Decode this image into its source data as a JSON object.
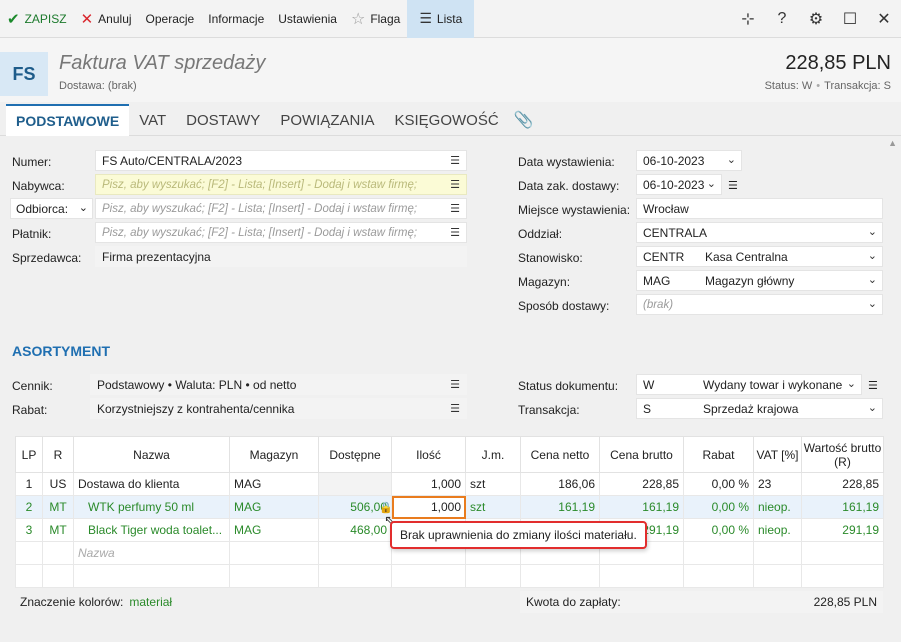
{
  "toolbar": {
    "save": "ZAPISZ",
    "cancel": "Anuluj",
    "operations": "Operacje",
    "info": "Informacje",
    "settings": "Ustawienia",
    "flag": "Flaga",
    "list": "Lista"
  },
  "header": {
    "logo": "FS",
    "title": "Faktura VAT sprzedaży",
    "subtitle": "Dostawa: (brak)",
    "amount": "228,85 PLN",
    "status_label": "Status:",
    "status_value": "W",
    "trans_label": "Transakcja:",
    "trans_value": "S"
  },
  "tabs": [
    "PODSTAWOWE",
    "VAT",
    "DOSTAWY",
    "POWIĄZANIA",
    "KSIĘGOWOŚĆ"
  ],
  "form_left": {
    "numer_label": "Numer:",
    "numer_value": "FS Auto/CENTRALA/2023",
    "nabywca_label": "Nabywca:",
    "nabywca_placeholder": "Pisz, aby wyszukać; [F2] - Lista; [Insert] - Dodaj i wstaw firmę;",
    "odbiorca_label": "Odbiorca:",
    "odbiorca_placeholder": "Pisz, aby wyszukać; [F2] - Lista; [Insert] - Dodaj i wstaw firmę;",
    "platnik_label": "Płatnik:",
    "platnik_placeholder": "Pisz, aby wyszukać; [F2] - Lista; [Insert] - Dodaj i wstaw firmę;",
    "sprzedawca_label": "Sprzedawca:",
    "sprzedawca_value": "Firma prezentacyjna"
  },
  "form_right": {
    "data_wyst_label": "Data wystawienia:",
    "data_wyst_value": "06-10-2023",
    "data_dost_label": "Data zak. dostawy:",
    "data_dost_value": "06-10-2023",
    "miejsce_label": "Miejsce wystawienia:",
    "miejsce_value": "Wrocław",
    "oddzial_label": "Oddział:",
    "oddzial_value": "CENTRALA",
    "stanowisko_label": "Stanowisko:",
    "stanowisko_code": "CENTR",
    "stanowisko_name": "Kasa Centralna",
    "magazyn_label": "Magazyn:",
    "magazyn_code": "MAG",
    "magazyn_name": "Magazyn główny",
    "sposob_label": "Sposób dostawy:",
    "sposob_placeholder": "(brak)"
  },
  "asortyment": {
    "title": "ASORTYMENT",
    "cennik_label": "Cennik:",
    "cennik_value": "Podstawowy • Waluta: PLN • od netto",
    "rabat_label": "Rabat:",
    "rabat_value": "Korzystniejszy z kontrahenta/cennika",
    "status_label": "Status dokumentu:",
    "status_code": "W",
    "status_name": "Wydany towar i wykonane",
    "transakcja_label": "Transakcja:",
    "transakcja_code": "S",
    "transakcja_name": "Sprzedaż krajowa"
  },
  "table": {
    "headers": [
      "LP",
      "R",
      "Nazwa",
      "Magazyn",
      "Dostępne",
      "Ilość",
      "J.m.",
      "Cena netto",
      "Cena brutto",
      "Rabat",
      "VAT [%]",
      "Wartość brutto (R)"
    ],
    "rows": [
      {
        "lp": "1",
        "r": "US",
        "nazwa": "Dostawa do klienta",
        "magazyn": "MAG",
        "dostepne": "",
        "ilosc": "1,000",
        "jm": "szt",
        "netto": "186,06",
        "brutto": "228,85",
        "rabat": "0,00 %",
        "vat": "23",
        "wartosc": "228,85"
      },
      {
        "lp": "2",
        "r": "MT",
        "nazwa": "WTK perfumy 50 ml",
        "magazyn": "MAG",
        "dostepne": "506,00",
        "ilosc": "1,000",
        "jm": "szt",
        "netto": "161,19",
        "brutto": "161,19",
        "rabat": "0,00 %",
        "vat": "nieop.",
        "wartosc": "161,19"
      },
      {
        "lp": "3",
        "r": "MT",
        "nazwa": "Black Tiger woda toalet...",
        "magazyn": "MAG",
        "dostepne": "468,00",
        "ilosc": "",
        "jm": "",
        "netto": "",
        "brutto": "291,19",
        "rabat": "0,00 %",
        "vat": "nieop.",
        "wartosc": "291,19"
      }
    ],
    "new_row_placeholder": "Nazwa"
  },
  "tooltip": "Brak uprawnienia do zmiany ilości materiału.",
  "footer": {
    "colors_label": "Znaczenie kolorów:",
    "colors_material": "materiał",
    "to_pay_label": "Kwota do zapłaty:",
    "to_pay_value": "228,85 PLN"
  }
}
